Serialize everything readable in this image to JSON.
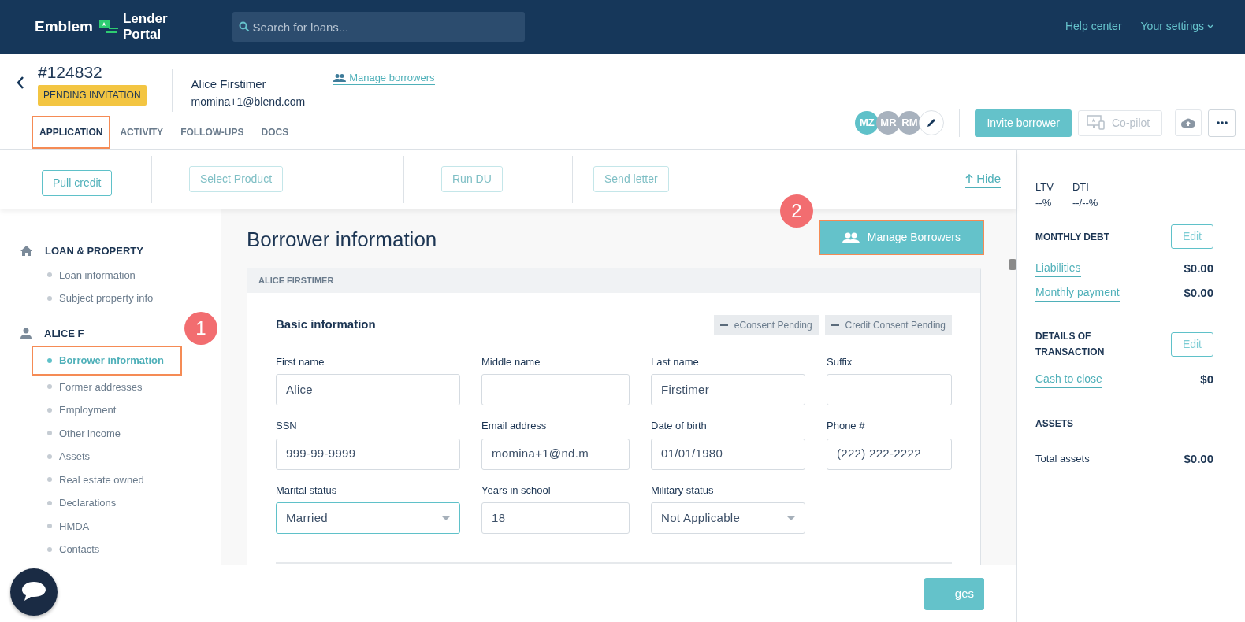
{
  "header": {
    "logo": {
      "brand": "Emblem",
      "product_lines": [
        "Lender",
        "Portal"
      ]
    },
    "search": {
      "placeholder": "Search for loans..."
    },
    "links": [
      {
        "label": "Help center",
        "kind": "link"
      },
      {
        "label": "Your settings",
        "kind": "dropdown"
      }
    ]
  },
  "loan": {
    "number": "#124832",
    "status": "PENDING INVITATION",
    "borrower_name": "Alice Firstimer",
    "borrower_email": "momina+1@blend.com",
    "manage_link": "Manage borrowers"
  },
  "tabs": [
    {
      "label": "APPLICATION",
      "selected": true,
      "highlighted": true
    },
    {
      "label": "ACTIVITY",
      "selected": false,
      "highlighted": false
    },
    {
      "label": "FOLLOW-UPS",
      "selected": false,
      "highlighted": false
    },
    {
      "label": "DOCS",
      "selected": false,
      "highlighted": false
    }
  ],
  "avatars": [
    {
      "initials": "MZ",
      "color": "#5fc1c9"
    },
    {
      "initials": "MR",
      "color": "#a8b2be"
    },
    {
      "initials": "RM",
      "color": "#a8b2be"
    }
  ],
  "header_actions": {
    "invite": "Invite borrower",
    "copilot": {
      "label": "Co-pilot",
      "disabled": true
    }
  },
  "toolbar": {
    "buttons": [
      {
        "label": "Pull credit",
        "disabled": false
      },
      {
        "label": "Select Product",
        "disabled": true
      },
      {
        "label": "Run DU",
        "disabled": true
      },
      {
        "label": "Send letter",
        "disabled": true
      }
    ],
    "hide": "Hide"
  },
  "sidebar": {
    "sections": [
      {
        "title": "LOAN & PROPERTY",
        "items": [
          {
            "label": "Loan information",
            "selected": false,
            "highlighted": false
          },
          {
            "label": "Subject property info",
            "selected": false,
            "highlighted": false
          }
        ]
      },
      {
        "title": "ALICE F",
        "items": [
          {
            "label": "Borrower information",
            "selected": true,
            "highlighted": true
          },
          {
            "label": "Former addresses",
            "selected": false,
            "highlighted": false
          },
          {
            "label": "Employment",
            "selected": false,
            "highlighted": false
          },
          {
            "label": "Other income",
            "selected": false,
            "highlighted": false
          },
          {
            "label": "Assets",
            "selected": false,
            "highlighted": false
          },
          {
            "label": "Real estate owned",
            "selected": false,
            "highlighted": false
          },
          {
            "label": "Declarations",
            "selected": false,
            "highlighted": false
          },
          {
            "label": "HMDA",
            "selected": false,
            "highlighted": false
          },
          {
            "label": "Contacts",
            "selected": false,
            "highlighted": false
          }
        ]
      }
    ]
  },
  "main": {
    "title": "Borrower information",
    "manage_button": {
      "label": "Manage Borrowers",
      "highlighted": true
    },
    "card": {
      "header": "ALICE FIRSTIMER",
      "section_title": "Basic information",
      "badges": [
        "eConsent Pending",
        "Credit Consent Pending"
      ],
      "fields": [
        {
          "label": "First name",
          "value": "Alice",
          "kind": "text",
          "focused": false
        },
        {
          "label": "Middle name",
          "kind": "text",
          "focused": false
        },
        {
          "label": "Last name",
          "value": "Firstimer",
          "kind": "text",
          "focused": false
        },
        {
          "label": "Suffix",
          "kind": "text",
          "focused": false
        },
        {
          "label": "SSN",
          "value": "999-99-9999",
          "kind": "text",
          "focused": false
        },
        {
          "label": "Email address",
          "value": "momina+1@nd.m",
          "kind": "text",
          "focused": false
        },
        {
          "label": "Date of birth",
          "value": "01/01/1980",
          "kind": "text",
          "focused": false
        },
        {
          "label": "Phone #",
          "value": "(222) 222-2222",
          "kind": "text",
          "focused": false
        },
        {
          "label": "Marital status",
          "value": "Married",
          "kind": "select",
          "focused": true
        },
        {
          "label": "Years in school",
          "value": "18",
          "kind": "text",
          "focused": false
        },
        {
          "label": "Military status",
          "value": "Not Applicable",
          "kind": "select",
          "focused": false
        }
      ]
    }
  },
  "footer": {
    "save_button": "ges"
  },
  "callouts": [
    {
      "number": "1"
    },
    {
      "number": "2"
    }
  ],
  "summary": {
    "ratios": [
      {
        "label": "LTV",
        "value": "--%"
      },
      {
        "label": "DTI",
        "value": "--/--%"
      }
    ],
    "sections": [
      {
        "title": "MONTHLY DEBT",
        "edit": "Edit",
        "rows": [
          {
            "label": "Liabilities",
            "value": "$0.00",
            "kind": "link"
          },
          {
            "label": "Monthly payment",
            "value": "$0.00",
            "kind": "link"
          }
        ]
      },
      {
        "title": "DETAILS OF TRANSACTION",
        "edit": "Edit",
        "rows": [
          {
            "label": "Cash to close",
            "value": "$0",
            "kind": "link"
          }
        ]
      },
      {
        "title": "ASSETS",
        "rows": [
          {
            "label": "Total assets",
            "value": "$0.00",
            "kind": "text"
          }
        ]
      }
    ]
  }
}
